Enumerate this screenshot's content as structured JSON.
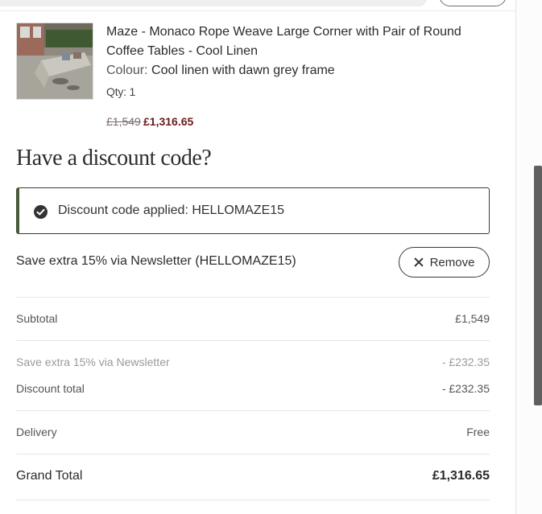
{
  "product": {
    "image_icon": "outdoor-corner-sofa-photo",
    "title": "Maze - Monaco Rope Weave Large Corner with Pair of Round Coffee Tables - Cool Linen",
    "colour_label": "Colour:",
    "colour_value": "Cool linen with dawn grey frame",
    "qty": "Qty: 1",
    "price_original": "£1,549",
    "price_sale": "£1,316.65"
  },
  "discount": {
    "heading": "Have a discount code?",
    "applied_text": "Discount code applied: HELLOMAZE15",
    "applied_icon": "check-circle-icon",
    "promo_description": "Save extra 15% via Newsletter (HELLOMAZE15)",
    "remove_label": "Remove",
    "remove_icon": "close-icon"
  },
  "summary": {
    "subtotal_label": "Subtotal",
    "subtotal_value": "£1,549",
    "promo_label": "Save extra 15% via Newsletter",
    "promo_value": "- £232.35",
    "discount_total_label": "Discount total",
    "discount_total_value": "- £232.35",
    "delivery_label": "Delivery",
    "delivery_value": "Free",
    "grand_total_label": "Grand Total",
    "grand_total_value": "£1,316.65"
  },
  "colors": {
    "accent_border": "#475a3a",
    "sale_price": "#6b1b1b",
    "text": "#2c2c2c"
  }
}
